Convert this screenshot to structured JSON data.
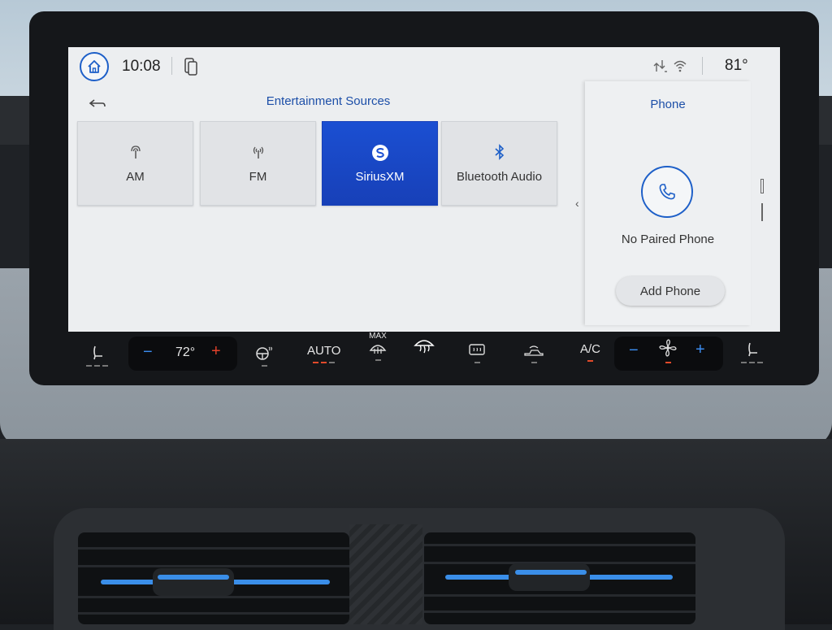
{
  "status_bar": {
    "time": "10:08",
    "outside_temp": "81°",
    "icons": [
      "home-icon",
      "phone-projection-icon",
      "signal-icon",
      "wifi-icon"
    ]
  },
  "entertainment": {
    "title": "Entertainment Sources",
    "sources": [
      {
        "label": "AM",
        "icon": "am-antenna-icon",
        "active": false
      },
      {
        "label": "FM",
        "icon": "fm-antenna-icon",
        "active": false
      },
      {
        "label": "SiriusXM",
        "icon": "siriusxm-icon",
        "active": true
      },
      {
        "label": "Bluetooth Audio",
        "icon": "bluetooth-icon",
        "active": false
      }
    ]
  },
  "phone_card": {
    "title": "Phone",
    "status": "No Paired Phone",
    "add_button": "Add Phone"
  },
  "climate": {
    "driver_temp": "72°",
    "auto_label": "AUTO",
    "max_label": "MAX",
    "ac_label": "A/C",
    "minus": "−",
    "plus": "+"
  },
  "colors": {
    "accent": "#1d5fc8",
    "active_tile": "#1b4fd2",
    "indicator_on": "#e24a2a"
  }
}
